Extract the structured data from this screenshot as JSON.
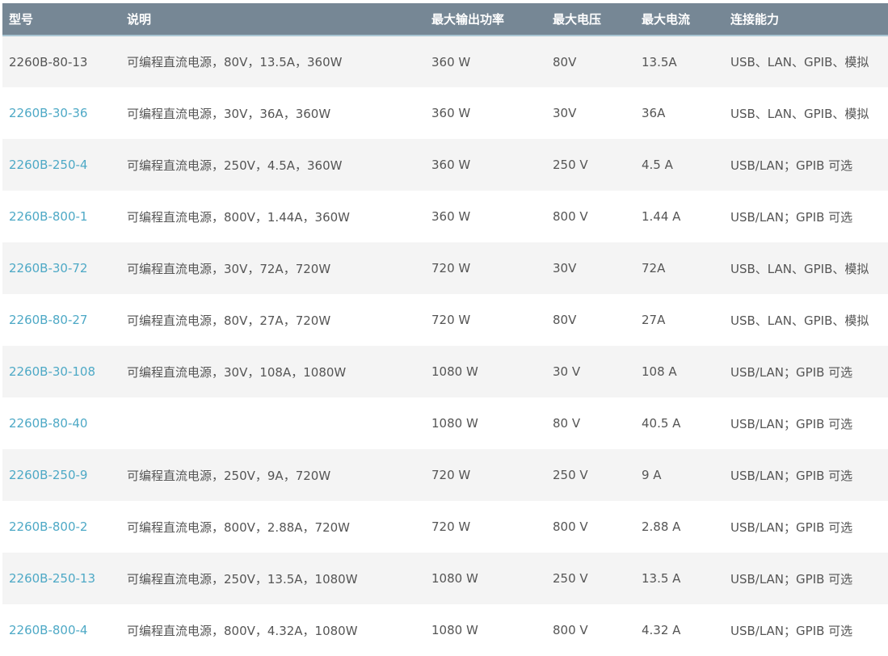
{
  "table": {
    "headers": {
      "model": "型号",
      "description": "说明",
      "max_power": "最大输出功率",
      "max_voltage": "最大电压",
      "max_current": "最大电流",
      "connectivity": "连接能力"
    },
    "rows": [
      {
        "model": "2260B-80-13",
        "link": false,
        "description": "可编程直流电源，80V，13.5A，360W",
        "max_power": "360 W",
        "max_voltage": "80V",
        "max_current": "13.5A",
        "connectivity": "USB、LAN、GPIB、模拟"
      },
      {
        "model": "2260B-30-36",
        "link": true,
        "description": "可编程直流电源，30V，36A，360W",
        "max_power": "360 W",
        "max_voltage": "30V",
        "max_current": "36A",
        "connectivity": "USB、LAN、GPIB、模拟"
      },
      {
        "model": "2260B-250-4",
        "link": true,
        "description": "可编程直流电源，250V，4.5A，360W",
        "max_power": "360 W",
        "max_voltage": "250 V",
        "max_current": "4.5 A",
        "connectivity": "USB/LAN；GPIB 可选"
      },
      {
        "model": "2260B-800-1",
        "link": true,
        "description": "可编程直流电源，800V，1.44A，360W",
        "max_power": "360 W",
        "max_voltage": "800 V",
        "max_current": "1.44 A",
        "connectivity": "USB/LAN；GPIB 可选"
      },
      {
        "model": "2260B-30-72",
        "link": true,
        "description": "可编程直流电源，30V，72A，720W",
        "max_power": "720 W",
        "max_voltage": "30V",
        "max_current": "72A",
        "connectivity": "USB、LAN、GPIB、模拟"
      },
      {
        "model": "2260B-80-27",
        "link": true,
        "description": "可编程直流电源，80V，27A，720W",
        "max_power": "720 W",
        "max_voltage": "80V",
        "max_current": "27A",
        "connectivity": "USB、LAN、GPIB、模拟"
      },
      {
        "model": "2260B-30-108",
        "link": true,
        "description": "可编程直流电源，30V，108A，1080W",
        "max_power": "1080 W",
        "max_voltage": "30 V",
        "max_current": "108 A",
        "connectivity": "USB/LAN；GPIB 可选"
      },
      {
        "model": "2260B-80-40",
        "link": true,
        "description": "",
        "max_power": "1080 W",
        "max_voltage": "80 V",
        "max_current": "40.5 A",
        "connectivity": "USB/LAN；GPIB 可选"
      },
      {
        "model": "2260B-250-9",
        "link": true,
        "description": "可编程直流电源，250V，9A，720W",
        "max_power": "720 W",
        "max_voltage": "250 V",
        "max_current": "9 A",
        "connectivity": "USB/LAN；GPIB 可选"
      },
      {
        "model": "2260B-800-2",
        "link": true,
        "description": "可编程直流电源，800V，2.88A，720W",
        "max_power": "720 W",
        "max_voltage": "800 V",
        "max_current": "2.88 A",
        "connectivity": "USB/LAN；GPIB 可选"
      },
      {
        "model": "2260B-250-13",
        "link": true,
        "description": "可编程直流电源，250V，13.5A，1080W",
        "max_power": "1080 W",
        "max_voltage": "250 V",
        "max_current": "13.5 A",
        "connectivity": "USB/LAN；GPIB 可选"
      },
      {
        "model": "2260B-800-4",
        "link": true,
        "description": "可编程直流电源，800V，4.32A，1080W",
        "max_power": "1080 W",
        "max_voltage": "800 V",
        "max_current": "4.32 A",
        "connectivity": "USB/LAN；GPIB 可选"
      }
    ]
  },
  "colors": {
    "header_bg": "#768795",
    "header_border": "#a9c6d3",
    "link": "#4ea9c6",
    "text": "#555555",
    "row_alt": "#f4f4f4"
  }
}
